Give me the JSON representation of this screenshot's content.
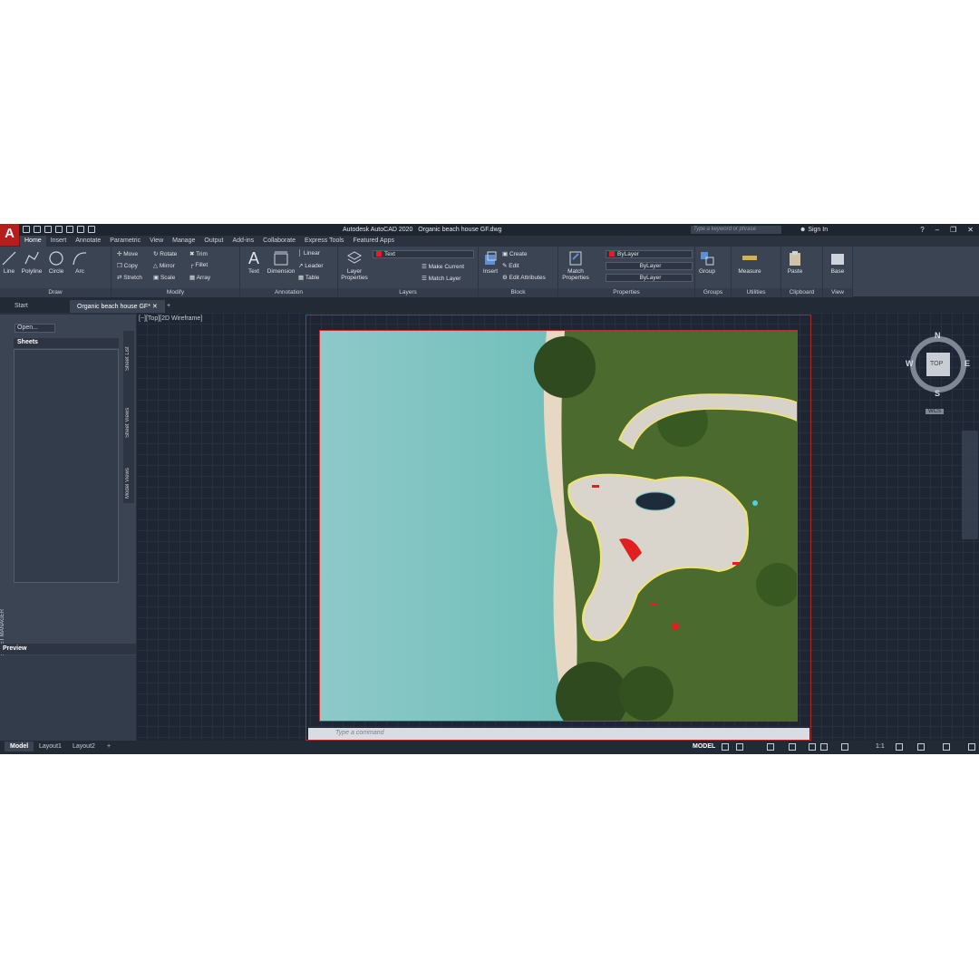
{
  "app": {
    "logo": "A",
    "title": "Autodesk AutoCAD 2020",
    "file": "Organic beach house GF.dwg",
    "search_placeholder": "Type a keyword or phrase",
    "sign_in": "Sign In"
  },
  "ribbon_tabs": [
    "Home",
    "Insert",
    "Annotate",
    "Parametric",
    "View",
    "Manage",
    "Output",
    "Add-ins",
    "Collaborate",
    "Express Tools",
    "Featured Apps"
  ],
  "ribbon": {
    "draw": {
      "label": "Draw",
      "tools": [
        "Line",
        "Polyline",
        "Circle",
        "Arc"
      ]
    },
    "modify": {
      "label": "Modify",
      "tools": [
        "Move",
        "Rotate",
        "Trim",
        "Copy",
        "Mirror",
        "Fillet",
        "Stretch",
        "Scale",
        "Array"
      ]
    },
    "annotation": {
      "label": "Annotation",
      "text": "Text",
      "dimension": "Dimension",
      "linear": "Linear",
      "leader": "Leader",
      "table": "Table"
    },
    "layers": {
      "label": "Layers",
      "layer_properties": "Layer Properties",
      "current_layer": "Text",
      "make_current": "Make Current",
      "match_layer": "Match Layer"
    },
    "block": {
      "label": "Block",
      "insert": "Insert",
      "create": "Create",
      "edit": "Edit",
      "edit_attributes": "Edit Attributes"
    },
    "properties": {
      "label": "Properties",
      "match": "Match Properties",
      "color": "ByLayer",
      "linetype": "ByLayer",
      "lineweight": "ByLayer"
    },
    "groups": {
      "label": "Groups",
      "group": "Group"
    },
    "utilities": {
      "label": "Utilities",
      "measure": "Measure"
    },
    "clipboard": {
      "label": "Clipboard",
      "paste": "Paste"
    },
    "view": {
      "label": "View",
      "base": "Base"
    }
  },
  "doc_tabs": [
    "Start",
    "Organic beach house GF*"
  ],
  "palette": {
    "open": "Open...",
    "sheets": "Sheets",
    "side_tabs": [
      "Sheet List",
      "Sheet Views",
      "Model Views"
    ],
    "vertical_title": "SHEET SET MANAGER",
    "preview": "Preview"
  },
  "viewport": {
    "label": "[−][Top][2D Wireframe]",
    "compass": {
      "n": "N",
      "s": "S",
      "e": "E",
      "w": "W",
      "top": "TOP",
      "wcs": "WCS"
    },
    "command_placeholder": "Type a command"
  },
  "layout_tabs": [
    "Model",
    "Layout1",
    "Layout2"
  ],
  "status": {
    "mode": "MODEL",
    "scale": "1:1"
  },
  "colors": {
    "accent": "#b81d1d",
    "bg": "#2b3340",
    "ribbon": "#3b4453"
  }
}
